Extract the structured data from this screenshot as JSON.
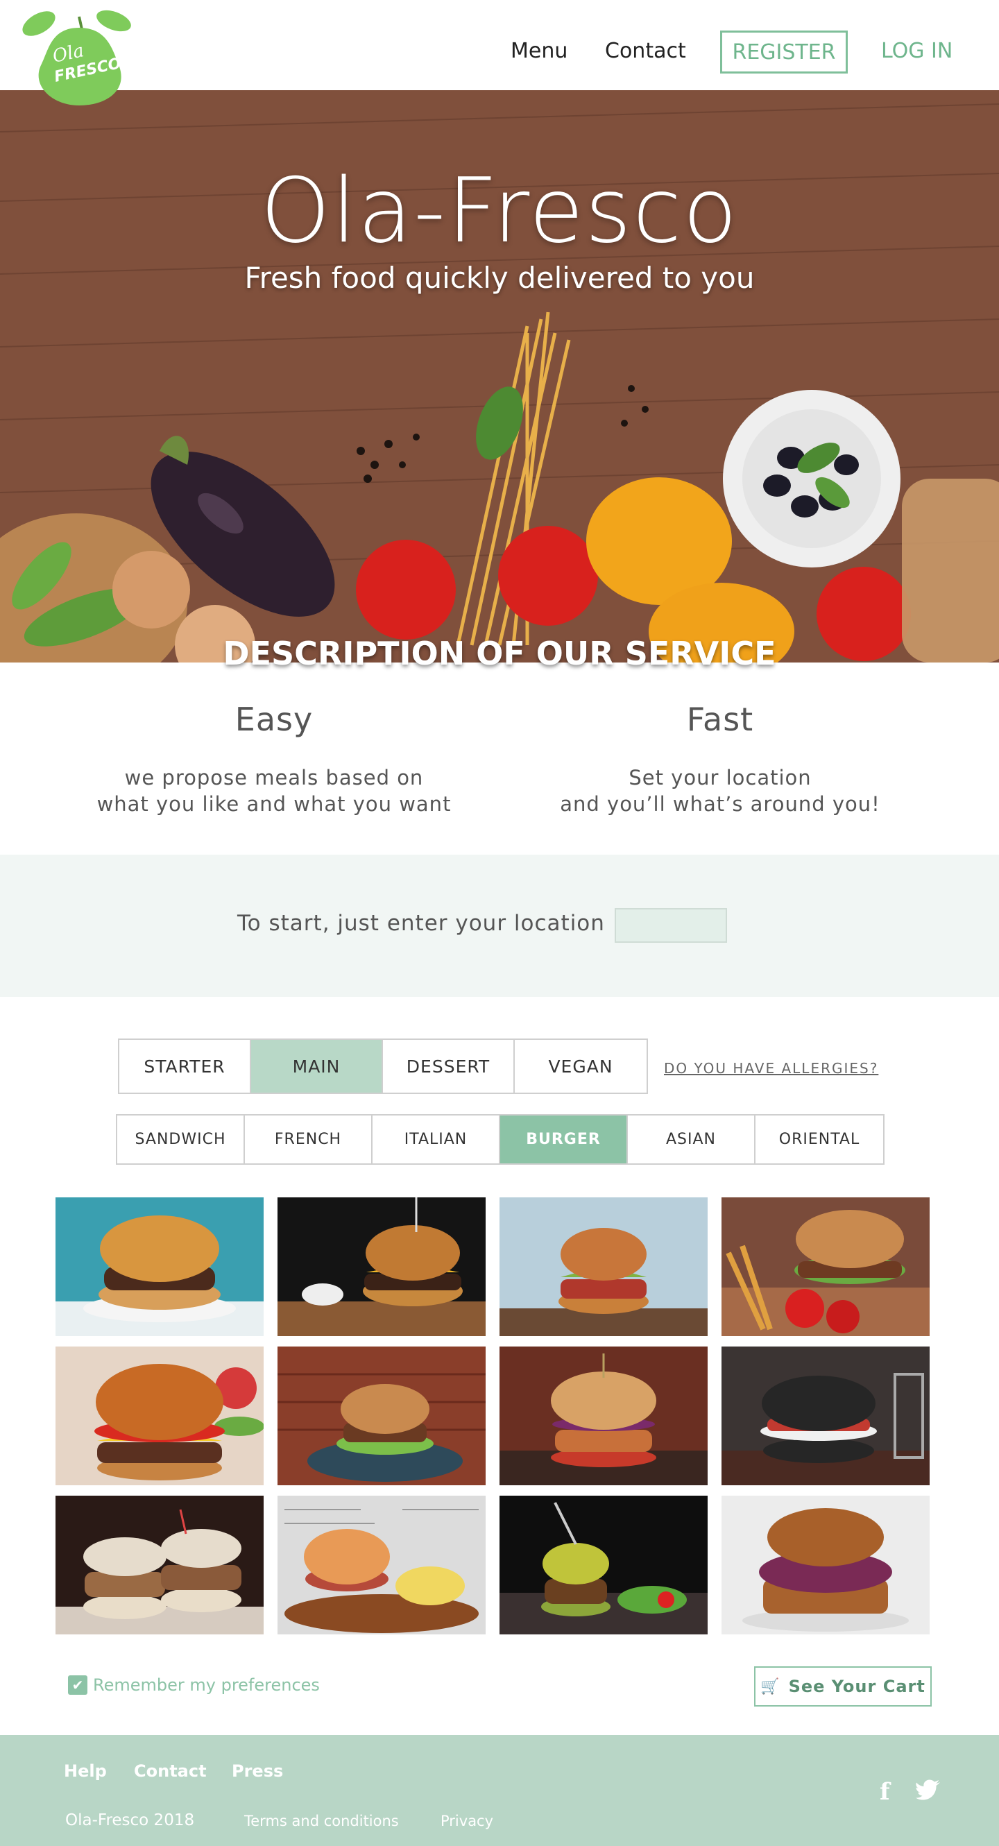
{
  "header": {
    "logo_text_top": "Ola",
    "logo_text_bottom": "FRESCO",
    "nav": {
      "menu": "Menu",
      "contact": "Contact",
      "register": "REGISTER",
      "login": "LOG IN"
    }
  },
  "hero": {
    "title": "Ola-Fresco",
    "subtitle": "Fresh food quickly delivered to you",
    "section_heading": "DESCRIPTION OF OUR SERVICE"
  },
  "service": {
    "easy": {
      "title": "Easy",
      "line1": "we propose meals based on",
      "line2": "what you like and what you want"
    },
    "fast": {
      "title": "Fast",
      "line1": "Set your location",
      "line2": "and you’ll what’s around you!"
    }
  },
  "location": {
    "label": "To start, just enter your location",
    "value": ""
  },
  "categories": {
    "tabs": [
      "STARTER",
      "MAIN",
      "DESSERT",
      "VEGAN"
    ],
    "active": "MAIN",
    "allergies": "DO YOU HAVE ALLERGIES?"
  },
  "cuisines": {
    "tabs": [
      "SANDWICH",
      "FRENCH",
      "ITALIAN",
      "BURGER",
      "ASIAN",
      "ORIENTAL"
    ],
    "active": "BURGER"
  },
  "footer_actions": {
    "remember": "Remember my preferences",
    "remember_checked": true,
    "cart": "See Your Cart",
    "cart_icon": "cart-icon"
  },
  "footer": {
    "help": "Help",
    "contact": "Contact",
    "press": "Press",
    "copyright": "Ola-Fresco 2018",
    "terms": "Terms and conditions",
    "privacy": "Privacy",
    "social": [
      "facebook-icon",
      "twitter-icon"
    ]
  },
  "colors": {
    "accent": "#8cc3a6",
    "accent_light": "#b8d8c7",
    "logo_green": "#7fcb5b"
  }
}
